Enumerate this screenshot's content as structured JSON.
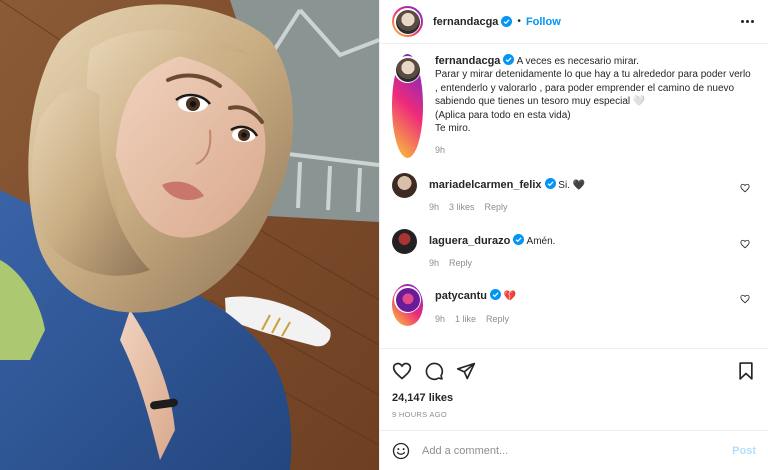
{
  "post": {
    "author": "fernandacga",
    "follow_label": "Follow",
    "dot": "•",
    "caption_lines": [
      "A veces es necesario mirar.",
      "Parar y mirar detenidamente lo que hay a tu alrededor para poder verlo , entenderlo y valorarlo , para poder emprender el camino de nuevo sabiendo que tienes un tesoro muy especial 🤍",
      "(Aplica para todo en esta vida)",
      "Te miro."
    ],
    "caption_time": "9h"
  },
  "comments": [
    {
      "user": "mariadelcarmen_felix",
      "text": "Si. 🖤",
      "time": "9h",
      "likes": "3 likes",
      "reply": "Reply"
    },
    {
      "user": "laguera_durazo",
      "text": "Amén.",
      "time": "9h",
      "reply": "Reply"
    },
    {
      "user": "patycantu",
      "text": "💔",
      "time": "9h",
      "likes": "1 like",
      "reply": "Reply"
    }
  ],
  "stats": {
    "likes": "24,147 likes",
    "posted": "9 HOURS AGO"
  },
  "composer": {
    "placeholder": "Add a comment...",
    "post_label": "Post"
  },
  "icons": {
    "like": "heart-icon",
    "comment": "comment-bubble-icon",
    "share": "paper-plane-icon",
    "save": "bookmark-icon",
    "emoji": "smiley-icon",
    "more": "more-dots-icon",
    "verified": "verified-badge-icon"
  },
  "colors": {
    "accent": "#0095f6",
    "post_disabled": "#b2dffc",
    "muted": "#8e8e8e",
    "text": "#262626"
  }
}
